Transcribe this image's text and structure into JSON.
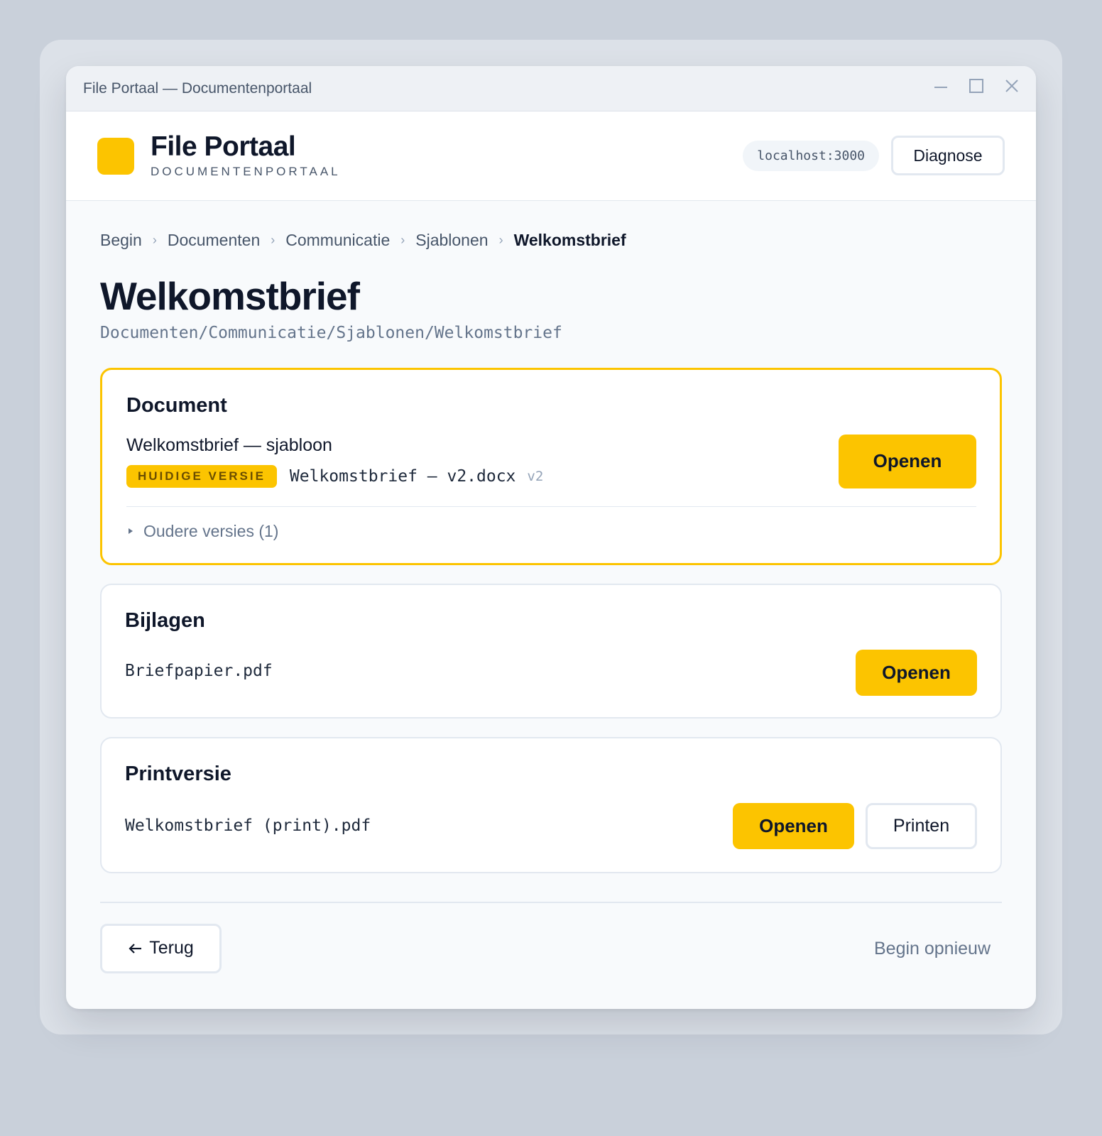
{
  "window": {
    "title": "File Portaal — Documentenportaal"
  },
  "header": {
    "brand_name": "File Portaal",
    "brand_subtitle": "DOCUMENTENPORTAAL",
    "host": "localhost:3000",
    "diagnose_label": "Diagnose",
    "accent_color": "#fcc400"
  },
  "breadcrumb": {
    "items": [
      "Begin",
      "Documenten",
      "Communicatie",
      "Sjablonen"
    ],
    "current": "Welkomstbrief",
    "separator": "›"
  },
  "page": {
    "title": "Welkomstbrief",
    "path": "Documenten/Communicatie/Sjablonen/Welkomstbrief"
  },
  "document_card": {
    "title": "Document",
    "name": "Welkomstbrief — sjabloon",
    "badge": "HUIDIGE VERSIE",
    "file": "Welkomstbrief – v2.docx",
    "version": "v2",
    "open_label": "Openen",
    "older_versions": "Oudere versies (1)"
  },
  "attachments_card": {
    "title": "Bijlagen",
    "file": "Briefpapier.pdf",
    "open_label": "Openen"
  },
  "print_card": {
    "title": "Printversie",
    "file": "Welkomstbrief (print).pdf",
    "open_label": "Openen",
    "print_label": "Printen"
  },
  "footer": {
    "back_label": "Terug",
    "restart_label": "Begin opnieuw"
  }
}
